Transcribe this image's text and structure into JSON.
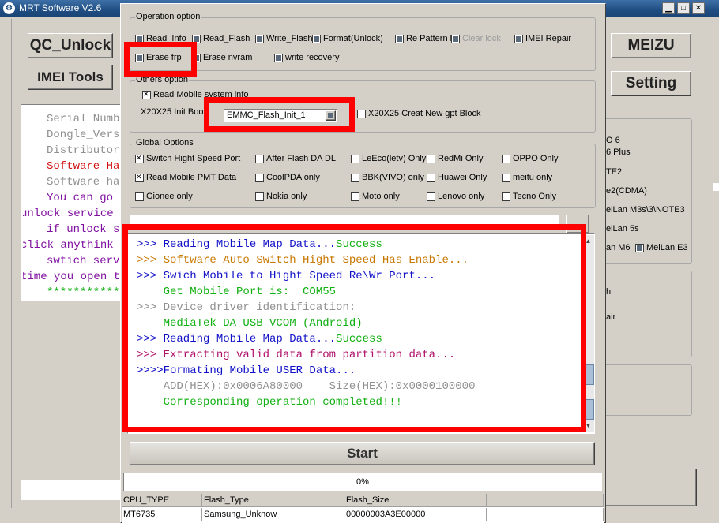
{
  "window": {
    "title": "MRT Software V2.6",
    "app_icon": "gear-icon",
    "title_buttons": [
      "minimize-icon",
      "maximize-icon",
      "close-icon"
    ]
  },
  "left_panel": {
    "qc_unlock": "QC_Unlock",
    "imei_tools": "IMEI Tools",
    "info_lines": [
      {
        "text": "Serial Numb",
        "color": "gray"
      },
      {
        "text": "Dongle_Vers",
        "color": "gray"
      },
      {
        "text": "Distributor",
        "color": "gray"
      },
      {
        "text": "Software Ha",
        "color": "red"
      },
      {
        "text": "Software ha",
        "color": "gray"
      },
      {
        "text": "You can go",
        "color": "purple"
      },
      {
        "text": "unlock service",
        "color": "purple"
      },
      {
        "text": "if unlock s",
        "color": "purple"
      },
      {
        "text": "click anythink",
        "color": "purple"
      },
      {
        "text": "swtich serv",
        "color": "purple"
      },
      {
        "text": "time you open t",
        "color": "purple"
      },
      {
        "text": "************",
        "color": "green"
      }
    ]
  },
  "right_panel": {
    "meizu": "MEIZU",
    "setting": "Setting",
    "models": [
      "O 6",
      "6 Plus",
      "TE2",
      "e2(CDMA)",
      "eiLan M3s\\3\\NOTE3",
      "eiLan 5s",
      "an M6",
      "MeiLan E3",
      "h",
      "air"
    ]
  },
  "operation_option": {
    "label": "Operation option",
    "items": [
      {
        "label": "Read_Info",
        "state": "dot"
      },
      {
        "label": "Read_Flash",
        "state": "dot"
      },
      {
        "label": "Write_Flash",
        "state": "dot"
      },
      {
        "label": "Format(Unlock)",
        "state": "dot"
      },
      {
        "label": "Re Pattern lo",
        "state": "dot"
      },
      {
        "label": "Clear lock",
        "state": "dot",
        "disabled": true
      },
      {
        "label": "IMEI Repair",
        "state": "dot"
      },
      {
        "label": "Erase frp",
        "state": "dot"
      },
      {
        "label": "Erase nvram",
        "state": "dot"
      },
      {
        "label": "write recovery",
        "state": "dot"
      }
    ]
  },
  "others_option": {
    "label": "Others option",
    "read_mobile_info": "Read Mobile system info",
    "init_label": "X20X25 Init Boo",
    "init_select": "EMMC_Flash_Init_1",
    "creat_gpt": "X20X25 Creat New gpt Block"
  },
  "global_options": {
    "label": "Global Options",
    "items": [
      {
        "label": "Switch Hight Speed Port",
        "state": "x"
      },
      {
        "label": "After Flash DA DL",
        "state": "none"
      },
      {
        "label": "LeEco(letv) Only",
        "state": "none"
      },
      {
        "label": "RedMi Only",
        "state": "none"
      },
      {
        "label": "OPPO Only",
        "state": "none"
      },
      {
        "label": "Read Mobile PMT Data",
        "state": "x"
      },
      {
        "label": "CoolPDA only",
        "state": "none"
      },
      {
        "label": "BBK(VIVO) only",
        "state": "none"
      },
      {
        "label": "Huawei Only",
        "state": "none"
      },
      {
        "label": "meitu only",
        "state": "none"
      },
      {
        "label": "Gionee only",
        "state": "none"
      },
      {
        "label": "Nokia only",
        "state": "none"
      },
      {
        "label": "Moto only",
        "state": "none"
      },
      {
        "label": "Lenovo only",
        "state": "none"
      },
      {
        "label": "Tecno Only",
        "state": "none"
      }
    ]
  },
  "log": {
    "lines": [
      [
        {
          "text": ">>> Reading Mobile Map Data...",
          "color": "blue"
        },
        {
          "text": "Success",
          "color": "green"
        }
      ],
      [
        {
          "text": ">>> Software Auto Switch Hight Speed Has Enable...",
          "color": "orange"
        }
      ],
      [
        {
          "text": ">>> Swich Mobile to Hight Speed Re\\Wr Port...",
          "color": "blue"
        }
      ],
      [
        {
          "text": "    Get Mobile Port is:  COM55",
          "color": "green"
        }
      ],
      [
        {
          "text": ">>> Device driver identification:",
          "color": "gray"
        }
      ],
      [
        {
          "text": "    MediaTek DA USB VCOM (Android)",
          "color": "green"
        }
      ],
      [
        {
          "text": ">>> Reading Mobile Map Data...",
          "color": "blue"
        },
        {
          "text": "Success",
          "color": "green"
        }
      ],
      [
        {
          "text": ">>> Extracting valid data from partition data...",
          "color": "magenta"
        }
      ],
      [
        {
          "text": ">>>>Formating Mobile USER Data...",
          "color": "blue"
        }
      ],
      [
        {
          "text": "    ADD(HEX):0x0006A80000    Size(HEX):0x0000100000",
          "color": "gray"
        }
      ],
      [
        {
          "text": "    Corresponding operation completed!!!",
          "color": "green"
        }
      ]
    ]
  },
  "start_button": "Start",
  "progress": {
    "value": 0,
    "label": "0%"
  },
  "info_table": {
    "headers": [
      "CPU_TYPE",
      "Flash_Type",
      "Flash_Size",
      ""
    ],
    "row": [
      "MT6735",
      "Samsung_Unknow",
      "00000003A3E00000",
      ""
    ]
  },
  "colors": {
    "highlight": "#ff0000",
    "titlebar": "#1f4d82"
  }
}
